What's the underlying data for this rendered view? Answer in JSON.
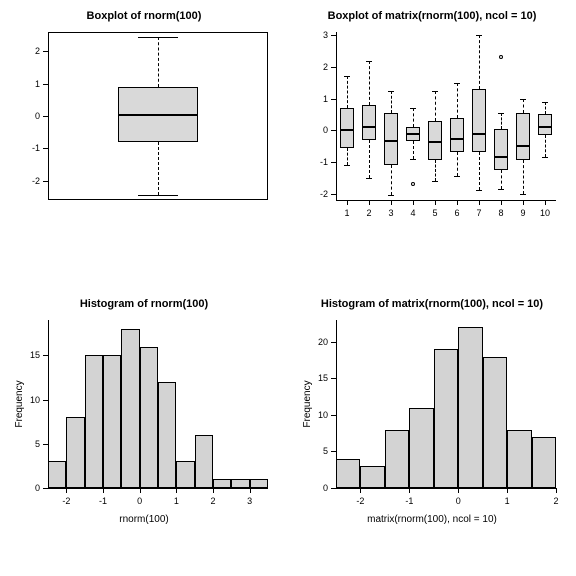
{
  "chart_data": [
    {
      "type": "boxplot",
      "title": "Boxplot of rnorm(100)",
      "ylim": [
        -2.6,
        2.6
      ],
      "yticks": [
        -2,
        -1,
        0,
        1,
        2
      ],
      "series": [
        {
          "x": 1,
          "min": -2.45,
          "q1": -0.8,
          "median": 0.05,
          "q3": 0.9,
          "max": 2.45,
          "outliers": []
        }
      ]
    },
    {
      "type": "boxplot",
      "title": "Boxplot of matrix(rnorm(100), ncol = 10)",
      "ylim": [
        -2.2,
        3.1
      ],
      "yticks": [
        -2,
        -1,
        0,
        1,
        2,
        3
      ],
      "xticks": [
        1,
        2,
        3,
        4,
        5,
        6,
        7,
        8,
        9,
        10
      ],
      "series": [
        {
          "x": 1,
          "min": -1.1,
          "q1": -0.55,
          "median": 0.05,
          "q3": 0.7,
          "max": 1.7,
          "outliers": []
        },
        {
          "x": 2,
          "min": -1.5,
          "q1": -0.3,
          "median": 0.15,
          "q3": 0.8,
          "max": 2.2,
          "outliers": []
        },
        {
          "x": 3,
          "min": -2.05,
          "q1": -1.1,
          "median": -0.3,
          "q3": 0.55,
          "max": 1.25,
          "outliers": []
        },
        {
          "x": 4,
          "min": -0.9,
          "q1": -0.35,
          "median": -0.08,
          "q3": 0.1,
          "max": 0.7,
          "outliers": [
            -1.7
          ]
        },
        {
          "x": 5,
          "min": -1.6,
          "q1": -0.95,
          "median": -0.35,
          "q3": 0.3,
          "max": 1.25,
          "outliers": []
        },
        {
          "x": 6,
          "min": -1.45,
          "q1": -0.7,
          "median": -0.25,
          "q3": 0.4,
          "max": 1.5,
          "outliers": []
        },
        {
          "x": 7,
          "min": -1.9,
          "q1": -0.7,
          "median": -0.1,
          "q3": 1.3,
          "max": 3.0,
          "outliers": []
        },
        {
          "x": 8,
          "min": -1.85,
          "q1": -1.25,
          "median": -0.8,
          "q3": 0.05,
          "max": 0.55,
          "outliers": [
            2.3
          ]
        },
        {
          "x": 9,
          "min": -2.0,
          "q1": -0.95,
          "median": -0.45,
          "q3": 0.55,
          "max": 1.0,
          "outliers": []
        },
        {
          "x": 10,
          "min": -0.85,
          "q1": -0.15,
          "median": 0.15,
          "q3": 0.5,
          "max": 0.9,
          "outliers": []
        }
      ]
    },
    {
      "type": "histogram",
      "title": "Histogram of rnorm(100)",
      "xlabel": "rnorm(100)",
      "ylabel": "Frequency",
      "xlim": [
        -2.5,
        3.5
      ],
      "ylim": [
        0,
        19
      ],
      "yticks": [
        0,
        5,
        10,
        15
      ],
      "xticks": [
        -2,
        -1,
        0,
        1,
        2,
        3
      ],
      "bin_width": 0.5,
      "bin_edges_start": -2.5,
      "counts": [
        3,
        8,
        15,
        15,
        18,
        16,
        12,
        3,
        6,
        1,
        1,
        1
      ]
    },
    {
      "type": "histogram",
      "title": "Histogram of matrix(rnorm(100), ncol = 10)",
      "xlabel": "matrix(rnorm(100), ncol = 10)",
      "ylabel": "Frequency",
      "xlim": [
        -2.5,
        2.0
      ],
      "ylim": [
        0,
        23
      ],
      "yticks": [
        0,
        5,
        10,
        15,
        20
      ],
      "xticks": [
        -2,
        -1,
        0,
        1,
        2
      ],
      "bin_width": 0.5,
      "bin_edges_start": -2.5,
      "counts": [
        4,
        3,
        8,
        11,
        19,
        22,
        18,
        8,
        7
      ]
    }
  ]
}
